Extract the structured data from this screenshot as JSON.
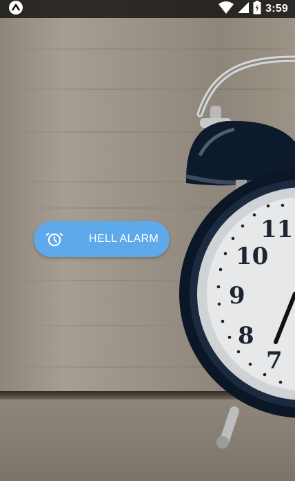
{
  "status_bar": {
    "app_icon": "arrow-up-notification-icon",
    "time": "3:59",
    "icons": [
      "wifi-icon",
      "cell-signal-icon",
      "battery-charging-icon"
    ]
  },
  "background": {
    "description_icon": "alarm-clock-photo",
    "clock_numerals": [
      "11",
      "10",
      "9",
      "8",
      "7"
    ]
  },
  "main": {
    "alarm_button": {
      "label": "HELL ALARM",
      "icon": "alarm-clock-icon",
      "color": "#5ea9ea"
    }
  },
  "colors": {
    "status_bar_bg": "#000000",
    "button_bg": "#5ea9ea",
    "button_text": "#ffffff"
  }
}
